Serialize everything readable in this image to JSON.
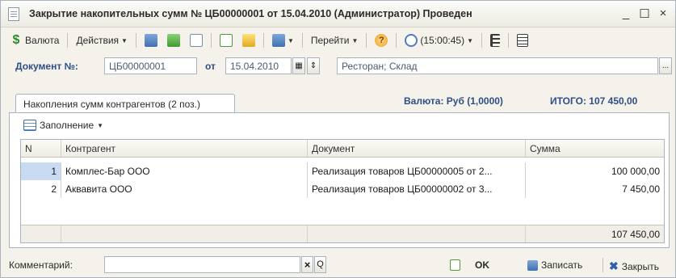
{
  "window": {
    "title": "Закрытие накопительных сумм № ЦБ00000001 от 15.04.2010 (Администратор) Проведен",
    "controls": [
      "_",
      "☐",
      "×"
    ]
  },
  "toolbar": {
    "currency_label": "Валюта",
    "actions_label": "Действия",
    "goto_label": "Перейти",
    "help_label": "?",
    "time_label": "(15:00:45)"
  },
  "document": {
    "number_label": "Документ №:",
    "number_value": "ЦБ00000001",
    "date_label": "от",
    "date_value": "15.04.2010",
    "spin_label": "⇕",
    "place_value": "Ресторан; Склад",
    "place_button": "..."
  },
  "tab": {
    "label": "Накопления сумм контрагентов (2 поз.)"
  },
  "totals": {
    "currency_text": "Валюта: Руб (1,0000)",
    "total_text": "ИТОГО: 107 450,00"
  },
  "fill_button": {
    "label": "Заполнение"
  },
  "table": {
    "columns": [
      "N",
      "Контрагент",
      "Документ",
      "Сумма"
    ],
    "rows": [
      {
        "n": "1",
        "contractor": "Комплес-Бар ООО",
        "document": "Реализация товаров ЦБ00000005 от 2...",
        "sum": "100 000,00"
      },
      {
        "n": "2",
        "contractor": "Аквавита ООО",
        "document": "Реализация товаров ЦБ00000002 от 3...",
        "sum": "7 450,00"
      }
    ],
    "footer_total": "107 450,00"
  },
  "bottom": {
    "comment_label": "Комментарий:",
    "comment_value": "",
    "clear_label": "×",
    "search_label": "Q",
    "ok_label": "OK",
    "save_label": "Записать",
    "close_label": "Закрыть"
  }
}
